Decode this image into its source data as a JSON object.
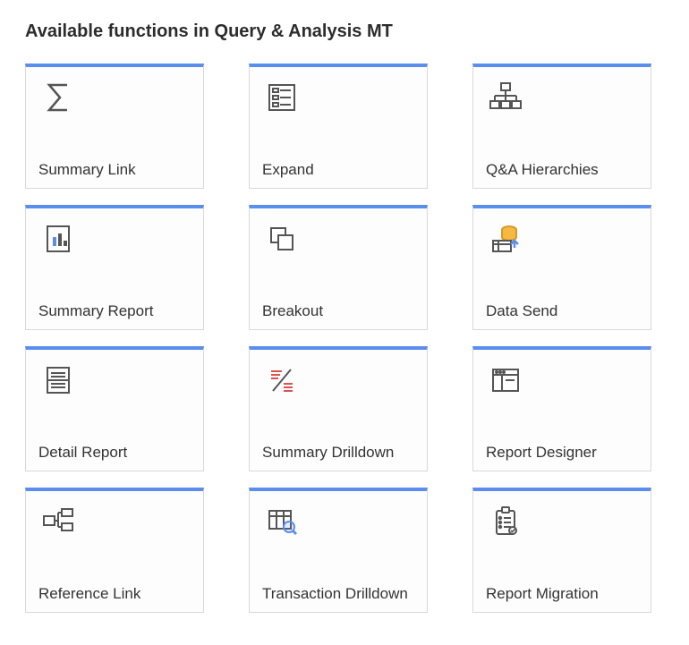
{
  "page": {
    "title": "Available functions in Query & Analysis MT"
  },
  "cards": [
    {
      "name": "summary-link",
      "icon": "sigma-icon",
      "label": "Summary Link"
    },
    {
      "name": "expand",
      "icon": "expand-form-icon",
      "label": "Expand"
    },
    {
      "name": "qa-hierarchies",
      "icon": "hierarchy-icon",
      "label": "Q&A Hierarchies"
    },
    {
      "name": "summary-report",
      "icon": "chart-doc-icon",
      "label": "Summary Report"
    },
    {
      "name": "breakout",
      "icon": "breakout-squares-icon",
      "label": "Breakout"
    },
    {
      "name": "data-send",
      "icon": "data-send-icon",
      "label": "Data Send"
    },
    {
      "name": "detail-report",
      "icon": "detail-list-icon",
      "label": "Detail Report"
    },
    {
      "name": "summary-drilldown",
      "icon": "summary-drill-icon",
      "label": "Summary Drilldown"
    },
    {
      "name": "report-designer",
      "icon": "report-designer-icon",
      "label": "Report Designer"
    },
    {
      "name": "reference-link",
      "icon": "reference-link-icon",
      "label": "Reference  Link"
    },
    {
      "name": "transaction-drill",
      "icon": "transaction-drill-icon",
      "label": "Transaction Drilldown"
    },
    {
      "name": "report-migration",
      "icon": "report-migration-icon",
      "label": "Report Migration"
    }
  ]
}
